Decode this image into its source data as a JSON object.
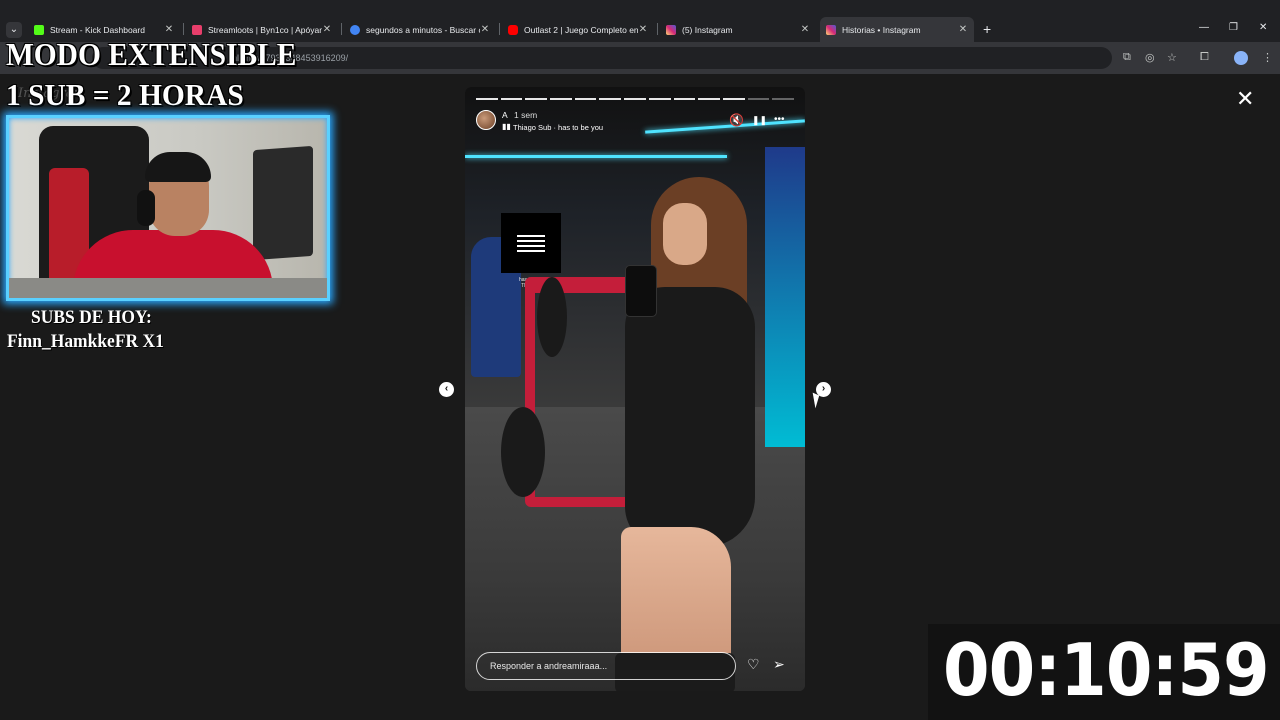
{
  "browser": {
    "tabs": [
      {
        "title": "Stream - Kick Dashboard",
        "favicon_color": "#53fc18",
        "active": false
      },
      {
        "title": "Streamloots | Byn1co | Apóyam",
        "favicon_color": "#e83e6b",
        "active": false
      },
      {
        "title": "segundos a minutos - Buscar c",
        "favicon_color": "#4285f4",
        "active": false
      },
      {
        "title": "Outlast 2 | Juego Completo en",
        "favicon_color": "#ff0000",
        "active": false
      },
      {
        "title": "(5) Instagram",
        "favicon_color": "#d6249f",
        "active": false
      },
      {
        "title": "Historias • Instagram",
        "favicon_color": "#d6249f",
        "active": true
      }
    ],
    "new_tab": "+",
    "url": "hlights/17936348453916209/",
    "window_controls": [
      "—",
      "❐",
      "✕"
    ]
  },
  "overlay": {
    "mode_text": "MODO EXTENSIBLE",
    "rule_text": "1 SUB = 2 HORAS",
    "faded_logo": "Instagram",
    "subs_title": "SUBS DE HOY:",
    "subs_name": "Finn_HamkkeFR X1",
    "timer": "00:10:59"
  },
  "story": {
    "user": "A",
    "time": "1 sem",
    "music_icon": "▮▮",
    "music": "Thiago Sub · has to be you",
    "poster_caption": "has to be you\nThiago Sub",
    "segments_total": 13,
    "segments_done": 11,
    "reply_placeholder": "Responder a andreamiraaa...",
    "close": "✕",
    "prev": "‹",
    "next": "›",
    "mute_icon": "🔇",
    "pause_icon": "❚❚",
    "more_icon": "•••",
    "like_icon": "♡",
    "share_icon": "➢"
  }
}
